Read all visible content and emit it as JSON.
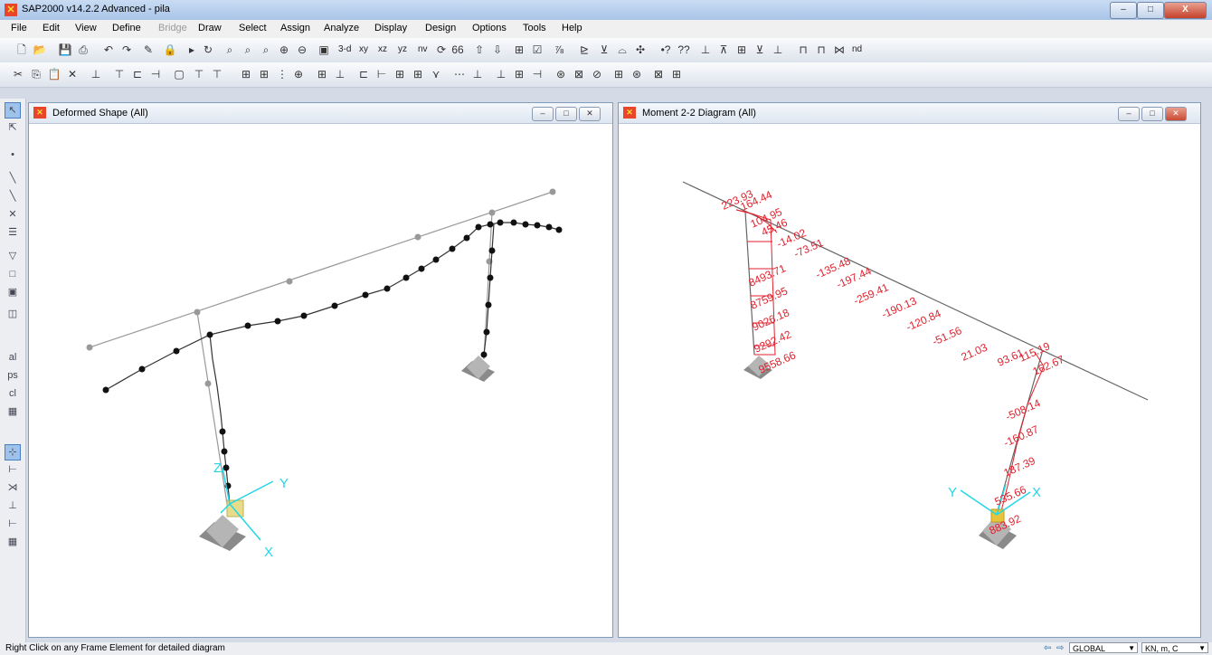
{
  "window": {
    "title": "SAP2000 v14.2.2 Advanced  - pila",
    "icon": "sap-logo-icon",
    "minimize": "–",
    "maximize": "□",
    "close": "X"
  },
  "menu": [
    "File",
    "Edit",
    "View",
    "Define",
    "Bridge",
    "Draw",
    "Select",
    "Assign",
    "Analyze",
    "Display",
    "Design",
    "Options",
    "Tools",
    "Help"
  ],
  "toolbar": {
    "view_3d": "3-d",
    "view_xy": "xy",
    "view_xz": "xz",
    "view_yz": "yz",
    "view_nv": "nv",
    "nd": "nd"
  },
  "left_pane": {
    "title": "Deformed Shape (All)"
  },
  "right_pane": {
    "title": "Moment 2-2 Diagram  (All)",
    "labels": [
      "223.93",
      "164.44",
      "104.95",
      "45.46",
      "-14.02",
      "-73.51",
      "-135.48",
      "-197.44",
      "-259.41",
      "-190.13",
      "-120.84",
      "-51.56",
      "21.03",
      "93.61",
      "115.19",
      "162.67",
      "8493.71",
      "8759.95",
      "9026.18",
      "9292.42",
      "9558.66",
      "-508.14",
      "-160.87",
      "187.39",
      "535.66",
      "883.92"
    ]
  },
  "axes": {
    "x": "X",
    "y": "Y",
    "z": "Z"
  },
  "status": {
    "text": "Right Click on any Frame Element for detailed diagram",
    "coord_system": "GLOBAL",
    "units": "KN, m, C"
  },
  "colors": {
    "moment_labels": "#e0222e",
    "axis": "#22d7e8",
    "deformed": "#111111",
    "undeformed": "#999999"
  }
}
